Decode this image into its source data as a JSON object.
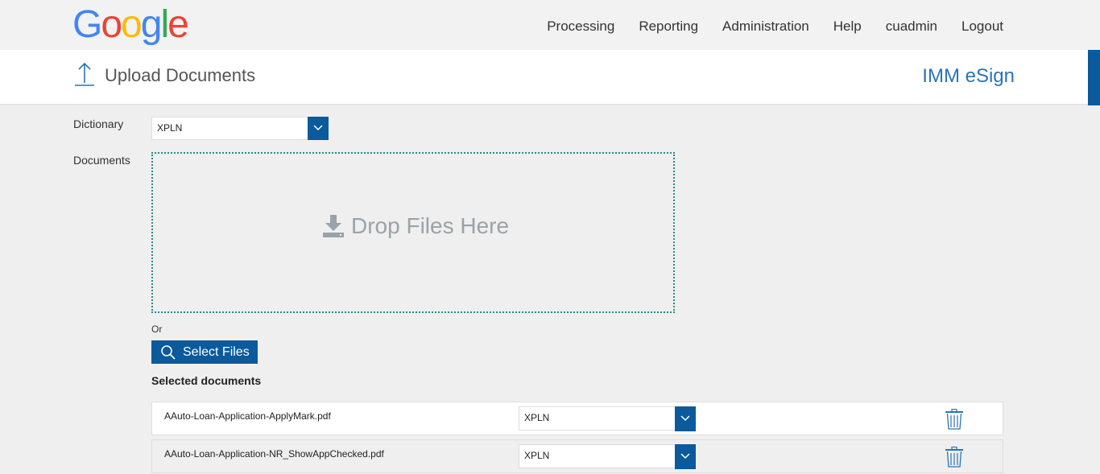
{
  "header": {
    "logo_letters": [
      {
        "ch": "G",
        "color": "#4285F4"
      },
      {
        "ch": "o",
        "color": "#EA4335"
      },
      {
        "ch": "o",
        "color": "#FBBC05"
      },
      {
        "ch": "g",
        "color": "#4285F4"
      },
      {
        "ch": "l",
        "color": "#34A853"
      },
      {
        "ch": "e",
        "color": "#EA4335"
      }
    ],
    "nav": [
      "Processing",
      "Reporting",
      "Administration",
      "Help",
      "cuadmin",
      "Logout"
    ]
  },
  "titlebar": {
    "page_title": "Upload Documents",
    "brand": "IMM eSign",
    "upload_icon": "upload-arrow-icon"
  },
  "form": {
    "dictionary_label": "Dictionary",
    "dictionary_value": "XPLN",
    "documents_label": "Documents",
    "dropzone_text": "Drop Files Here",
    "dropzone_icon": "download-icon",
    "or_text": "Or",
    "select_files_label": "Select Files",
    "select_files_icon": "search-icon",
    "selected_title": "Selected documents"
  },
  "selected_documents": [
    {
      "file": "AAuto-Loan-Application-ApplyMark.pdf",
      "dictionary": "XPLN"
    },
    {
      "file": "AAuto-Loan-Application-NR_ShowAppChecked.pdf",
      "dictionary": "XPLN"
    }
  ],
  "colors": {
    "accent": "#0a5a9c",
    "brand_text": "#2b74b2",
    "dropzone_border": "#2a8a8a",
    "background": "#efefef"
  }
}
